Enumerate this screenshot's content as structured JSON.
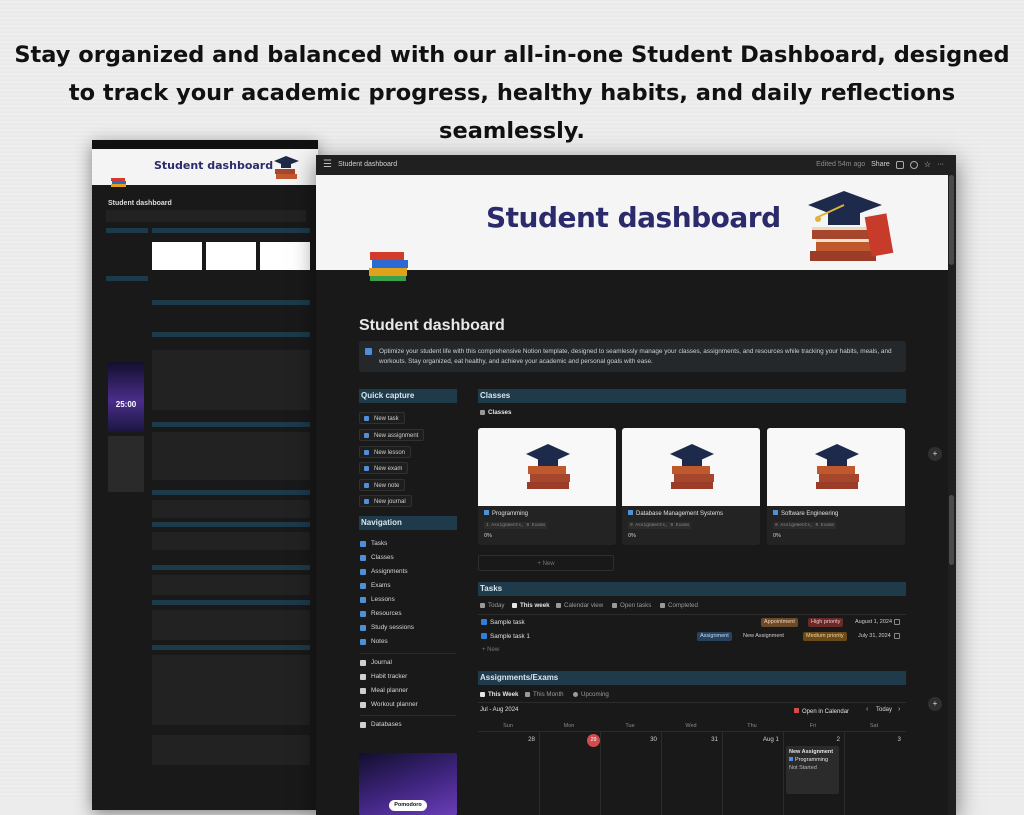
{
  "headline": "Stay organized and balanced with our all-in-one Student Dashboard, designed to track your academic progress, healthy habits, and daily reflections seamlessly.",
  "small_window": {
    "banner_title": "Student dashboard",
    "page_title": "Student dashboard",
    "pomodoro_time": "25:00"
  },
  "window": {
    "breadcrumb": "Student dashboard",
    "edited": "Edited 54m ago",
    "share": "Share",
    "banner_title": "Student dashboard",
    "page_title": "Student dashboard",
    "callout": "Optimize your student life with this comprehensive Notion template, designed to seamlessly manage your classes, assignments, and resources while tracking your habits, meals, and workouts. Stay organized, eat healthy, and achieve your academic and personal goals with ease.",
    "quick_capture": {
      "title": "Quick capture",
      "buttons": [
        "New task",
        "New assignment",
        "New lesson",
        "New exam",
        "New note",
        "New journal"
      ]
    },
    "navigation": {
      "title": "Navigation",
      "items": [
        "Tasks",
        "Classes",
        "Assignments",
        "Exams",
        "Lessons",
        "Resources",
        "Study sessions",
        "Notes"
      ],
      "items2": [
        "Journal",
        "Habit tracker",
        "Meal planner",
        "Workout planner"
      ],
      "databases": "Databases"
    },
    "pomodoro_label": "Pomodoro",
    "classes": {
      "title": "Classes",
      "view": "Classes",
      "cards": [
        {
          "name": "Programming",
          "tags": "1 Assignments, 0 Exams",
          "pct": "0%"
        },
        {
          "name": "Database Management Systems",
          "tags": "0 Assignments, 0 Exams",
          "pct": "0%"
        },
        {
          "name": "Software Engineering",
          "tags": "0 Assignments, 0 Exams",
          "pct": "0%"
        }
      ],
      "new_label": "+ New"
    },
    "tasks": {
      "title": "Tasks",
      "tabs": [
        "Today",
        "This week",
        "Calendar view",
        "Open tasks",
        "Completed"
      ],
      "rows": [
        {
          "name": "Sample task",
          "tag1": "Appointment",
          "tag2": "High priority",
          "date": "August 1, 2024"
        },
        {
          "name": "Sample task 1",
          "tag1": "Assignment",
          "tag2": "New Assignment",
          "tag3": "Medium priority",
          "date": "July 31, 2024"
        }
      ],
      "new_label": "+ New"
    },
    "assignments": {
      "title": "Assignments/Exams",
      "tabs": [
        "This Week",
        "This Month",
        "Upcoming"
      ],
      "range": "Jul - Aug 2024",
      "open_calendar": "Open in Calendar",
      "today_btn": "Today",
      "days": [
        "Sun",
        "Mon",
        "Tue",
        "Wed",
        "Thu",
        "Fri",
        "Sat"
      ],
      "dates": [
        "28",
        "29",
        "30",
        "31",
        "Aug 1",
        "2",
        "3"
      ],
      "event": {
        "title": "New Assignment",
        "class": "Programming",
        "status": "Not Started"
      }
    }
  },
  "colors": {
    "accent": "#4e8fd8",
    "section_header": "#1f3a4a",
    "banner_title": "#2b2a6b",
    "today": "#d24c4c"
  }
}
